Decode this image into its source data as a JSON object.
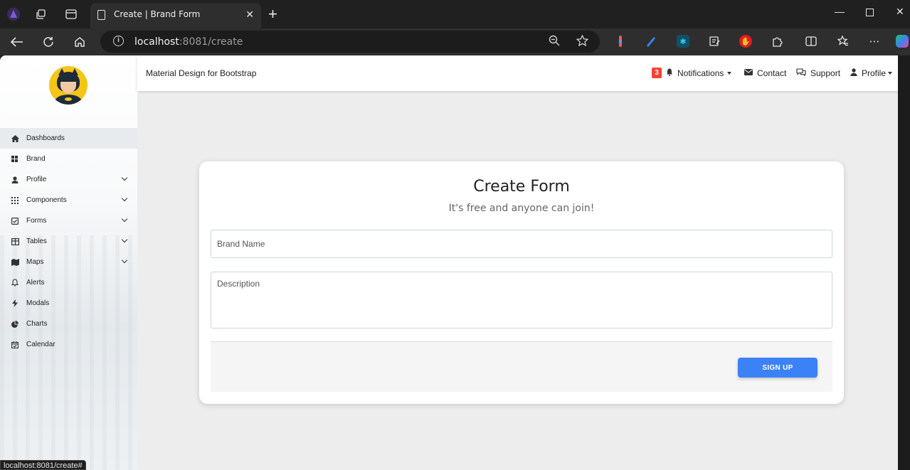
{
  "browser": {
    "tab_title": "Create | Brand Form",
    "url_host": "localhost",
    "url_rest": ":8081/create",
    "status_url": "localhost:8081/create#"
  },
  "topbar": {
    "brand": "Material Design for Bootstrap",
    "notifications_count": "3",
    "notifications_label": "Notifications",
    "contact_label": "Contact",
    "support_label": "Support",
    "profile_label": "Profile"
  },
  "sidebar": {
    "items": [
      {
        "label": "Dashboards",
        "icon": "home-icon"
      },
      {
        "label": "Brand",
        "icon": "grid-icon"
      },
      {
        "label": "Profile",
        "icon": "user-icon"
      },
      {
        "label": "Components",
        "icon": "apps-icon"
      },
      {
        "label": "Forms",
        "icon": "checkbox-icon"
      },
      {
        "label": "Tables",
        "icon": "table-icon"
      },
      {
        "label": "Maps",
        "icon": "map-icon"
      },
      {
        "label": "Alerts",
        "icon": "bell-icon"
      },
      {
        "label": "Modals",
        "icon": "bolt-icon"
      },
      {
        "label": "Charts",
        "icon": "pie-icon"
      },
      {
        "label": "Calendar",
        "icon": "calendar-icon"
      }
    ]
  },
  "form": {
    "title": "Create Form",
    "subtitle": "It's free and anyone can join!",
    "brand_name_placeholder": "Brand Name",
    "description_placeholder": "Description",
    "submit_label": "SIGN UP"
  }
}
